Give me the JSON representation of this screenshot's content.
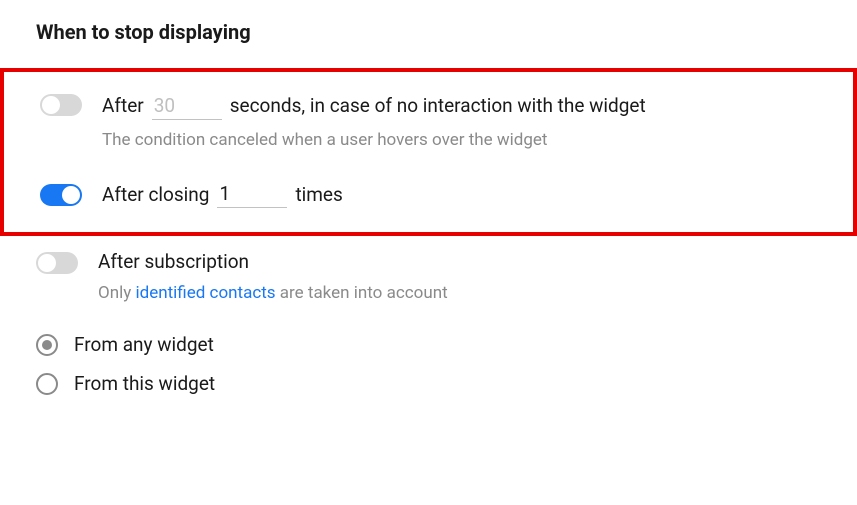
{
  "title": "When to stop displaying",
  "option1": {
    "prefix": "After",
    "seconds_value": "",
    "seconds_placeholder": "30",
    "suffix": "seconds, in case of no interaction with the widget",
    "help": "The condition canceled when a user hovers over the widget",
    "enabled": false
  },
  "option2": {
    "prefix": "After closing",
    "times_value": "1",
    "suffix": "times",
    "enabled": true
  },
  "option3": {
    "title": "After subscription",
    "help_prefix": "Only ",
    "help_link": "identified contacts",
    "help_suffix": " are taken into account",
    "enabled": false
  },
  "radio": {
    "any": "From any widget",
    "this": "From this widget",
    "selected": "any"
  }
}
